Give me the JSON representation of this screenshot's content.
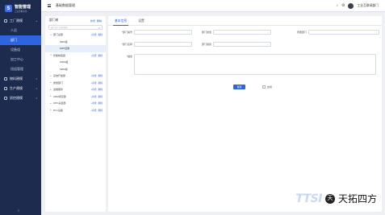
{
  "app": {
    "logo_mark": "S",
    "logo_title": "智能管理",
    "logo_subtitle": "工业互联平台"
  },
  "sidebar": {
    "groups": [
      {
        "label": "工厂建模",
        "items": [
          {
            "label": "人员"
          },
          {
            "label": "部门",
            "active": true
          },
          {
            "label": "设备组"
          },
          {
            "label": "加工中心"
          },
          {
            "label": "班组管理"
          }
        ]
      },
      {
        "label": "物料建模"
      },
      {
        "label": "生产建模"
      },
      {
        "label": "质控建模"
      }
    ],
    "collapse_icon": "≡"
  },
  "topbar": {
    "page_title": "基础数据管理",
    "user_name": "工业互联网部门"
  },
  "tree": {
    "title": "部门树",
    "actions": [
      "新增",
      "删除"
    ],
    "search_placeholder": "输入部门名称搜索",
    "rows": [
      {
        "level": 0,
        "caret": "▾",
        "label": "部门总部",
        "ops": [
          "+新增",
          "-删除"
        ]
      },
      {
        "level": 1,
        "caret": "",
        "label": "MES组",
        "ops": []
      },
      {
        "level": 1,
        "caret": "",
        "label": "ERP运维",
        "ops": [],
        "selected": true
      },
      {
        "level": 0,
        "caret": "▾",
        "label": "智能制造部",
        "ops": [
          "+新增",
          "-删除"
        ]
      },
      {
        "level": 1,
        "caret": "",
        "label": "WMS组",
        "ops": []
      },
      {
        "level": 1,
        "caret": "",
        "label": "SRM组",
        "ops": []
      },
      {
        "level": 0,
        "caret": "▸",
        "label": "系统开发部",
        "ops": [
          "+新增",
          "-删除"
        ]
      },
      {
        "level": 0,
        "caret": "▸",
        "label": "质量部门",
        "ops": [
          "+新增",
          "-删除"
        ]
      },
      {
        "level": 0,
        "caret": "▸",
        "label": "运维服务",
        "ops": [
          "+新增",
          "-删除"
        ]
      },
      {
        "level": 0,
        "caret": "▸",
        "label": "CRM项目部",
        "ops": [
          "+新增",
          "-删除"
        ]
      },
      {
        "level": 0,
        "caret": "▸",
        "label": "OPC采集部",
        "ops": [
          "+新增",
          "-删除"
        ]
      },
      {
        "level": 0,
        "caret": "▸",
        "label": "PLC设备",
        "ops": [
          "+新增",
          "-删除"
        ]
      }
    ]
  },
  "form": {
    "tabs": [
      "基本信息",
      "设置"
    ],
    "fields": {
      "dept_code": {
        "label": "部门编号",
        "value": ""
      },
      "dept_name": {
        "label": "部门名称",
        "value": ""
      },
      "dept_type": {
        "label": "部门类型",
        "value": ""
      },
      "dept_level": {
        "label": "部门级别",
        "value": ""
      },
      "parent_dept": {
        "label": "所属部门",
        "value": ""
      },
      "remark": {
        "label": "描述",
        "value": ""
      }
    },
    "save_label": "保存",
    "enable_label": "启用"
  },
  "watermark": {
    "logo_text": "TTSI",
    "bubble": "天",
    "name": "天拓四方"
  }
}
